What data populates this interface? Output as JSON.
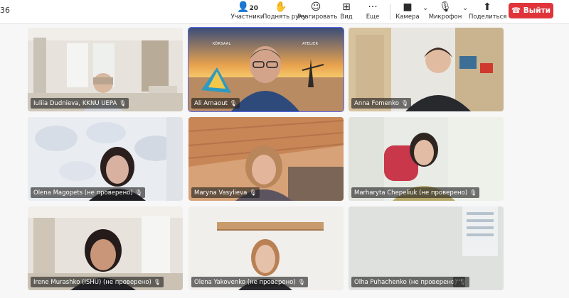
{
  "window": {
    "title_fragment": "36"
  },
  "toolbar": {
    "participants_count": "20",
    "participants_label": "Участники",
    "raise_hand_label": "Поднять руку",
    "react_label": "Реагировать",
    "view_label": "Вид",
    "more_label": "Еще",
    "camera_label": "Камера",
    "mic_label": "Микрофон",
    "share_label": "Поделиться",
    "leave_label": "Выйти"
  },
  "participants": [
    {
      "name": "Iuliia Dudnieva, KKNU UEPA"
    },
    {
      "name": "Ali Arnaout",
      "active": true,
      "poster_left": "KÖRSAAL",
      "poster_right": "ATELIER"
    },
    {
      "name": "Anna Fomenko"
    },
    {
      "name": "Olena Magopets (не проверено)"
    },
    {
      "name": "Maryna Vasylieva"
    },
    {
      "name": "Marharyta Chepeliuk (не проверено)"
    },
    {
      "name": "Irene Murashko (ISHU) (не проверено)"
    },
    {
      "name": "Olena Yakovenko (не проверено)"
    },
    {
      "name": "Olha Puhachenko (не проверено)"
    }
  ],
  "tile_more_label": "···",
  "colors": {
    "active_border": "#5b6cf0",
    "leave_button": "#e0343b"
  }
}
